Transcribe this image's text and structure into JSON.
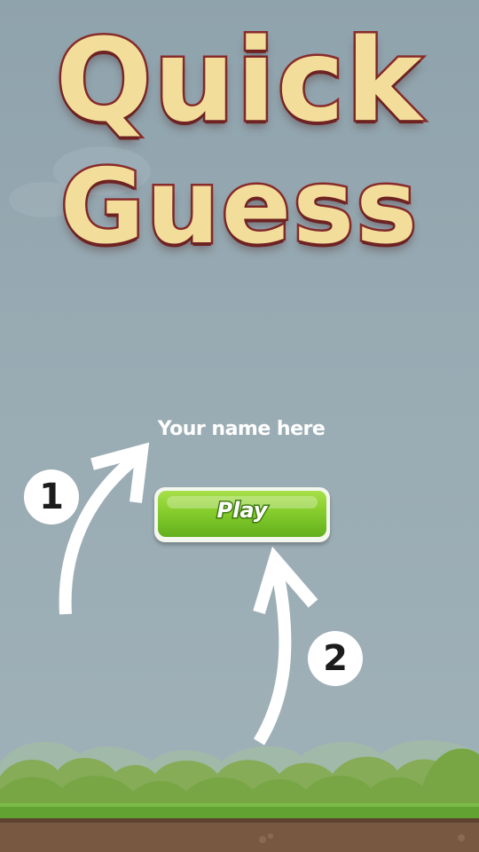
{
  "title": {
    "line1": "Quick",
    "line2": "Guess"
  },
  "name_field": {
    "placeholder": "Your name here",
    "value": ""
  },
  "play_button": {
    "label": "Play"
  },
  "tutorial": {
    "step1": "1",
    "step2": "2"
  },
  "colors": {
    "sky": "#99abb3",
    "title_fill": "#f3dd9a",
    "title_outline": "#8a2c2c",
    "button_green": "#86cc2c",
    "grass": "#7eb04a",
    "dirt": "#7a5a43"
  }
}
